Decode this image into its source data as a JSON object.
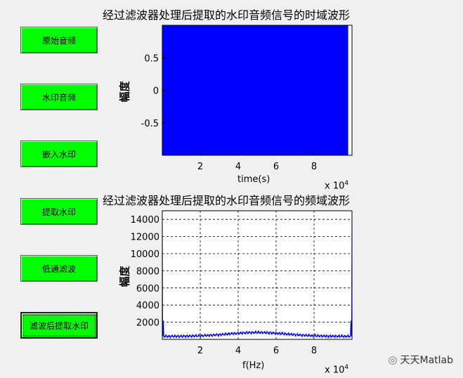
{
  "buttons": [
    {
      "label": "原始音频"
    },
    {
      "label": "水印音频"
    },
    {
      "label": "嵌入水印"
    },
    {
      "label": "提取水印"
    },
    {
      "label": "低通滤波"
    },
    {
      "label": "滤波后提取水印"
    }
  ],
  "colors": {
    "button": "#00ff00",
    "series": "#0000ff"
  },
  "chart_data": [
    {
      "type": "area",
      "title": "经过滤波器处理后提取的水印音频信号的时域波形",
      "xlabel": "time(s)",
      "ylabel": "幅度",
      "x_exponent": "x 10",
      "x_exponent_power": "4",
      "xlim": [
        0,
        100000
      ],
      "ylim": [
        -1,
        1
      ],
      "xticks": [
        "2",
        "4",
        "6",
        "8"
      ],
      "yticks": [
        "0.5",
        "0",
        "-0.5"
      ],
      "series": [
        {
          "values_range": [
            -1,
            1
          ]
        }
      ],
      "grid": false
    },
    {
      "type": "line",
      "title": "经过滤波器处理后提取的水印音频信号的频域波形",
      "xlabel": "f(Hz)",
      "ylabel": "幅度",
      "x_exponent": "x 10",
      "x_exponent_power": "4",
      "xlim": [
        0,
        100000
      ],
      "ylim": [
        0,
        15000
      ],
      "xticks": [
        "2",
        "4",
        "6",
        "8"
      ],
      "yticks": [
        "14000",
        "12000",
        "10000",
        "8000",
        "6000",
        "4000",
        "2000"
      ],
      "grid": true
    }
  ],
  "watermark": {
    "label": "天天Matlab"
  }
}
